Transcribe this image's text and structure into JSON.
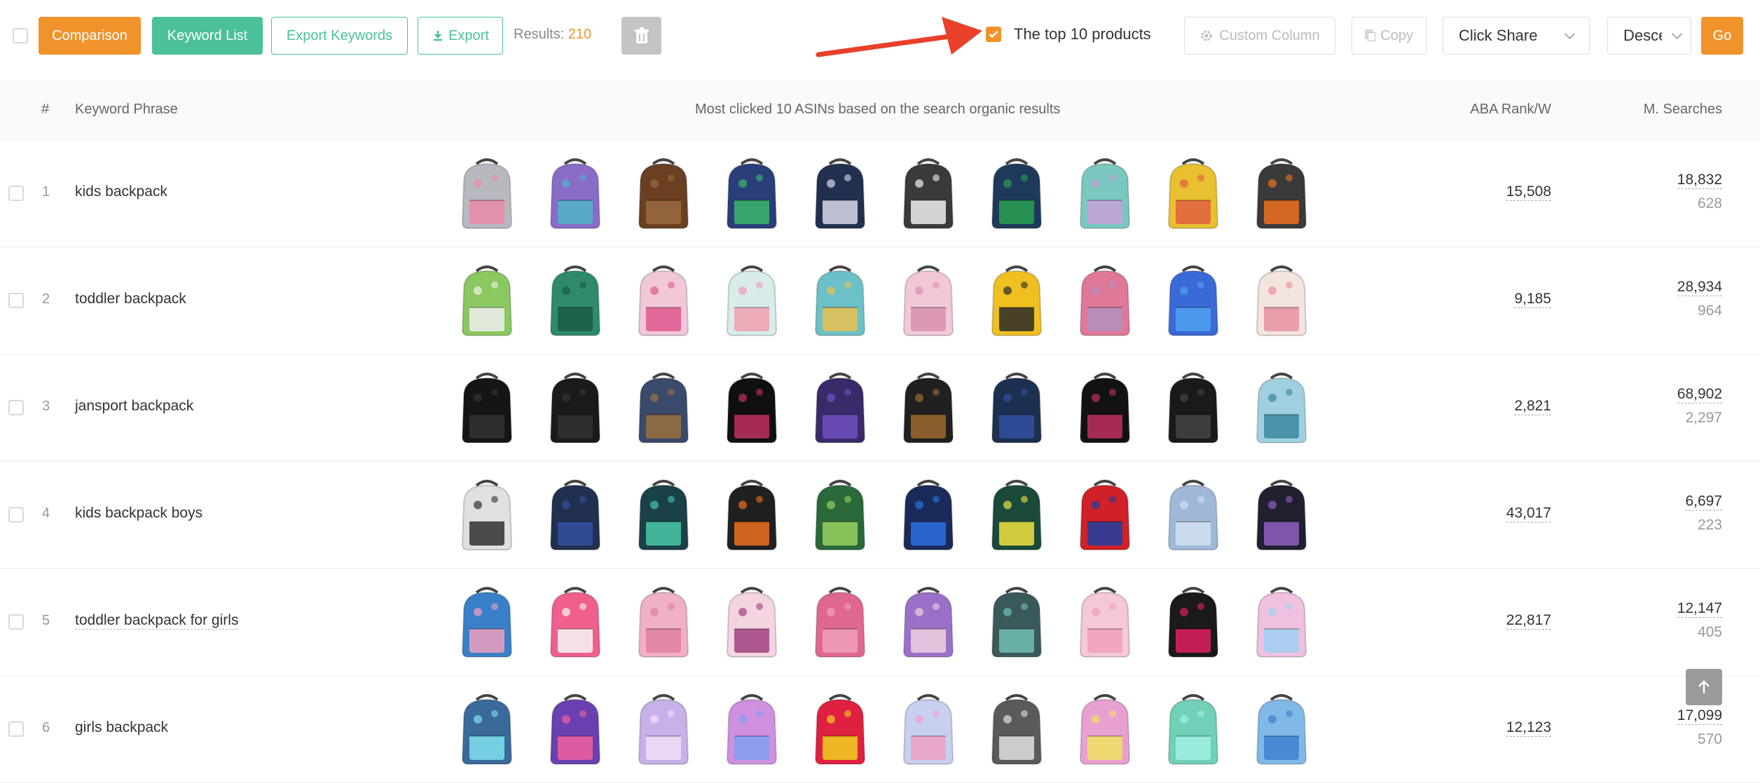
{
  "toolbar": {
    "comparison_label": "Comparison",
    "keyword_list_label": "Keyword List",
    "export_keywords_label": "Export Keywords",
    "export_label": "Export",
    "results_label": "Results:",
    "results_count": "210",
    "top10_label": "The top 10 products",
    "top10_checked": true,
    "custom_column_label": "Custom Column",
    "copy_label": "Copy",
    "sort_select_value": "Click Share",
    "order_select_value": "Desce",
    "go_label": "Go"
  },
  "table": {
    "headers": {
      "index": "#",
      "keyword": "Keyword Phrase",
      "products": "Most clicked 10 ASINs based on the search organic results",
      "aba_rank": "ABA Rank/W",
      "searches": "M. Searches"
    },
    "rows": [
      {
        "index": "1",
        "keyword": "kids backpack",
        "aba_rank": "15,508",
        "monthly_searches": "18,832",
        "searches_sub": "628",
        "product_colors": [
          "#b8b8c0",
          "#8a6bc8",
          "#6b3f22",
          "#2a3f7a",
          "#22304f",
          "#3a3a3a",
          "#1e3a5a",
          "#7ac8c0",
          "#e8c030",
          "#3a3a3a"
        ],
        "product_accents": [
          "#e88aa8",
          "#4fb3c8",
          "#9a6a40",
          "#3bb86a",
          "#d8d8e8",
          "#f0f0f0",
          "#28a050",
          "#c8a0d8",
          "#e06040",
          "#f07020"
        ]
      },
      {
        "index": "2",
        "keyword": "toddler backpack",
        "aba_rank": "9,185",
        "monthly_searches": "28,934",
        "searches_sub": "964",
        "product_colors": [
          "#8ac860",
          "#2e8a6a",
          "#f0c8d8",
          "#d8ecec",
          "#6cc0c8",
          "#f2c8d8",
          "#f0c020",
          "#e07898",
          "#3a6ad8",
          "#f4e4e0"
        ],
        "product_accents": [
          "#f0f0f0",
          "#1a5a48",
          "#e05890",
          "#f0a0b0",
          "#e8c050",
          "#d890b0",
          "#2a2a2a",
          "#b090c0",
          "#50a0f0",
          "#e890a0"
        ]
      },
      {
        "index": "3",
        "keyword": "jansport backpack",
        "aba_rank": "2,821",
        "monthly_searches": "68,902",
        "searches_sub": "2,297",
        "product_colors": [
          "#151515",
          "#1a1a1a",
          "#3a4a6a",
          "#101010",
          "#3a2a6a",
          "#202020",
          "#1e3050",
          "#121212",
          "#1a1a1a",
          "#a0d0e0"
        ],
        "product_accents": [
          "#333333",
          "#333333",
          "#9a7040",
          "#c03060",
          "#7050c0",
          "#a06a30",
          "#3050a0",
          "#c03060",
          "#444444",
          "#3a8aa0"
        ]
      },
      {
        "index": "4",
        "keyword": "kids backpack boys",
        "aba_rank": "43,017",
        "monthly_searches": "6,697",
        "searches_sub": "223",
        "product_colors": [
          "#e0e0e0",
          "#22304f",
          "#1a4048",
          "#202020",
          "#2a6a3a",
          "#1a2a5a",
          "#1a4a3a",
          "#d02028",
          "#a0b8d8",
          "#202030"
        ],
        "product_accents": [
          "#303030",
          "#3050a0",
          "#48c8a8",
          "#f07020",
          "#98d060",
          "#2a70e0",
          "#f0e040",
          "#2040a0",
          "#d0e0f0",
          "#9060c0"
        ]
      },
      {
        "index": "5",
        "keyword": "toddler backpack for girls",
        "aba_rank": "22,817",
        "monthly_searches": "12,147",
        "searches_sub": "405",
        "product_colors": [
          "#3a80c8",
          "#f0608a",
          "#f0b0c8",
          "#f4d4e0",
          "#e06890",
          "#9a70c8",
          "#3a5a5a",
          "#f4c8d8",
          "#1a1a1a",
          "#f0c0e0"
        ],
        "product_accents": [
          "#f0a0c0",
          "#f8f8f8",
          "#e080a0",
          "#a04080",
          "#f0a0b8",
          "#f0d0e0",
          "#70c0b0",
          "#f0a0b8",
          "#e02060",
          "#a0d0f0"
        ]
      },
      {
        "index": "6",
        "keyword": "girls backpack",
        "aba_rank": "12,123",
        "monthly_searches": "17,099",
        "searches_sub": "570",
        "product_colors": [
          "#3a6a9a",
          "#6a40b0",
          "#c8b0e8",
          "#d090e0",
          "#e02040",
          "#c8d0f0",
          "#5a5a5a",
          "#e8a0d0",
          "#70d0b8",
          "#80b8e8"
        ],
        "product_accents": [
          "#80e0f0",
          "#f060a0",
          "#f0e0f8",
          "#80a0f0",
          "#f0d020",
          "#f0a0c8",
          "#e0e0e0",
          "#f0e060",
          "#a0f0e0",
          "#4080d0"
        ]
      }
    ]
  },
  "colors": {
    "accent_orange": "#f0932b",
    "accent_green": "#4cc09a",
    "annotation_arrow": "#e8402a"
  }
}
